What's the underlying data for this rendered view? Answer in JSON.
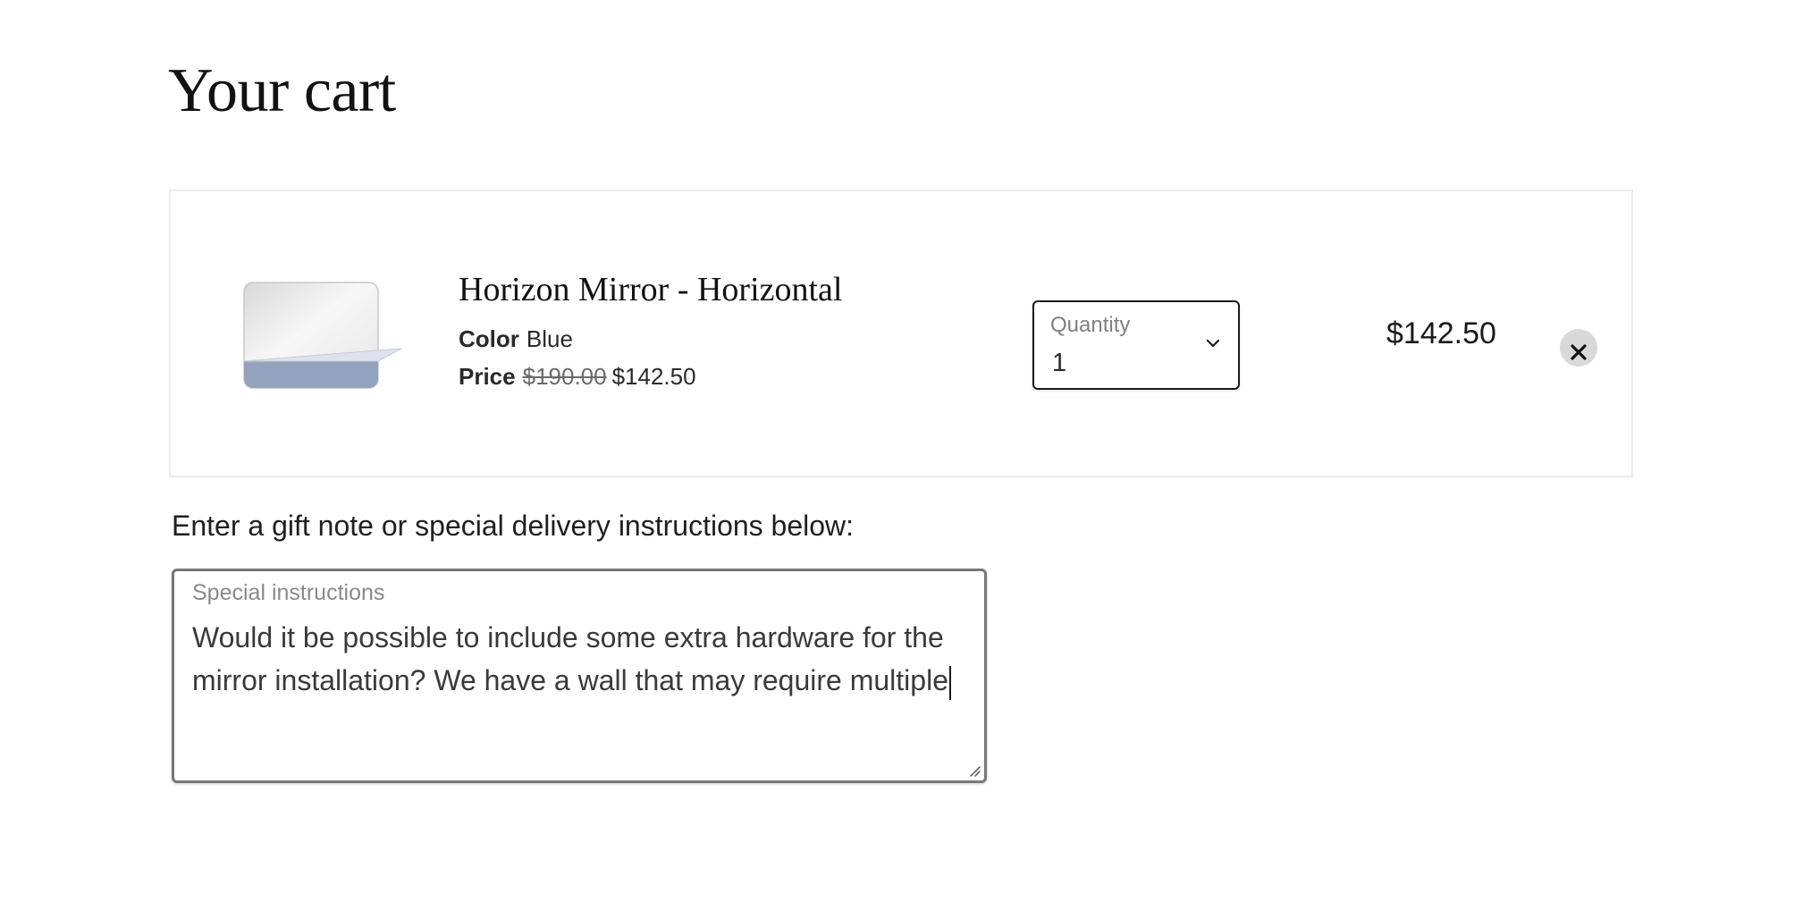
{
  "page": {
    "title": "Your cart"
  },
  "cart": {
    "item": {
      "name": "Horizon Mirror - Horizontal",
      "color_label": "Color",
      "color_value": "Blue",
      "price_label": "Price",
      "original_price": "$190.00",
      "sale_price": "$142.50",
      "line_total": "$142.50",
      "image_icon": "mirror-product-image",
      "remove_icon": "close-icon"
    },
    "quantity": {
      "label": "Quantity",
      "value": "1",
      "icon": "chevron-down-icon"
    }
  },
  "note": {
    "label": "Enter a gift note or special delivery instructions below:",
    "placeholder": "Special instructions",
    "value": "Would it be possible to include some extra hardware for the mirror installation? We have a wall that may require multiple"
  },
  "colors": {
    "mirror_base": "#94a3bd",
    "remove_button_bg": "#d9d9d9",
    "card_border": "#ececec"
  }
}
